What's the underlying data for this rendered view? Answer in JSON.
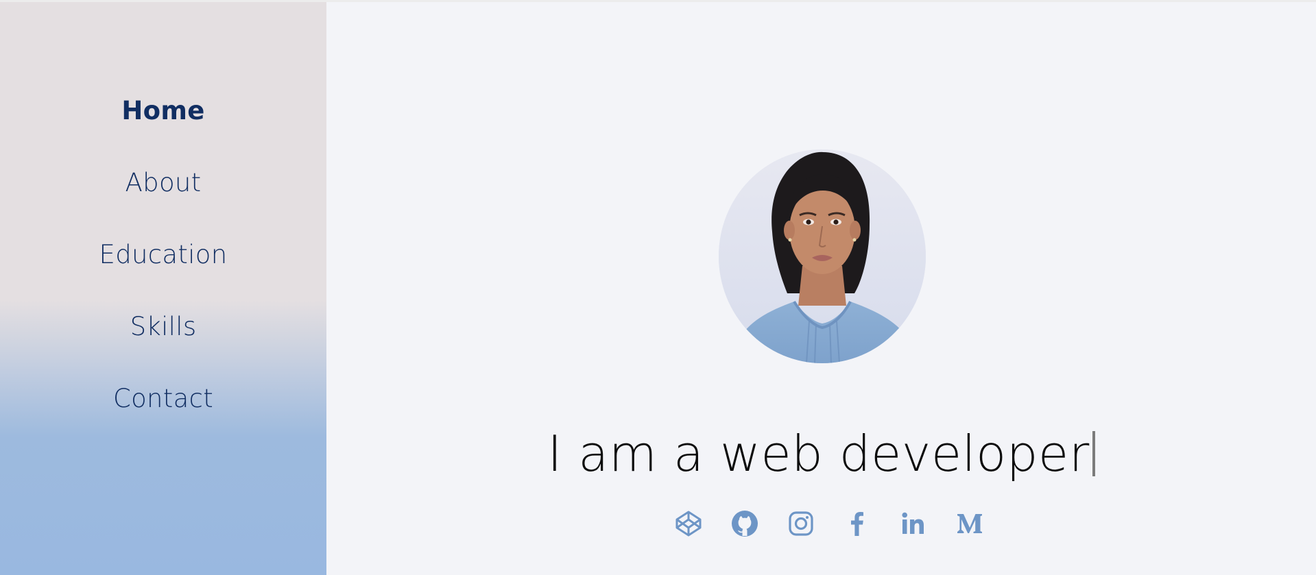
{
  "nav": {
    "items": [
      {
        "label": "Home",
        "active": true
      },
      {
        "label": "About",
        "active": false
      },
      {
        "label": "Education",
        "active": false
      },
      {
        "label": "Skills",
        "active": false
      },
      {
        "label": "Contact",
        "active": false
      }
    ]
  },
  "hero": {
    "headline": "I am a web developer",
    "avatar_icon": "profile-photo"
  },
  "socials": [
    {
      "name": "codepen",
      "icon": "codepen-icon"
    },
    {
      "name": "github",
      "icon": "github-icon"
    },
    {
      "name": "instagram",
      "icon": "instagram-icon"
    },
    {
      "name": "facebook",
      "icon": "facebook-icon"
    },
    {
      "name": "linkedin",
      "icon": "linkedin-icon",
      "glyph": "in"
    },
    {
      "name": "medium",
      "icon": "medium-icon",
      "glyph": "M"
    }
  ],
  "colors": {
    "nav_text": "#112e62",
    "icon": "#6d95c6",
    "sidebar_top": "#e4dfe1",
    "sidebar_bottom": "#99b8e0",
    "main_bg": "#f3f4f8"
  }
}
